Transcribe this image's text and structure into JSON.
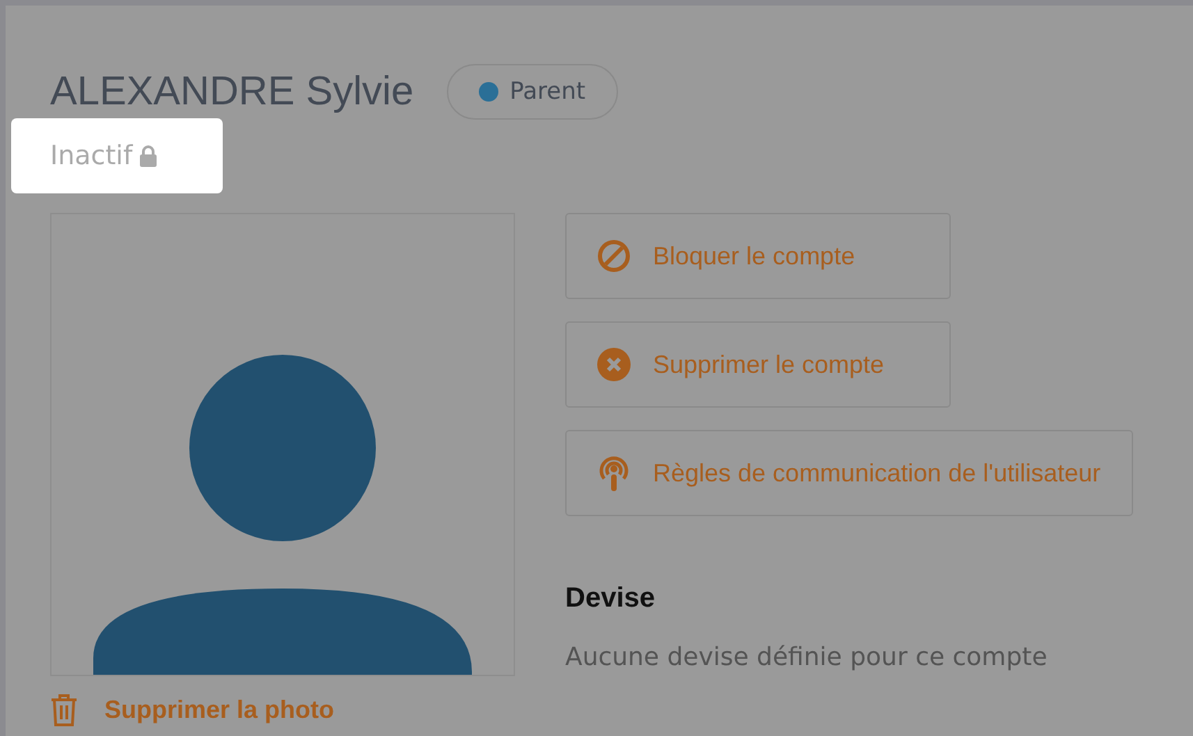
{
  "profile": {
    "name": "ALEXANDRE Sylvie",
    "role_badge": "Parent",
    "status": "Inactif"
  },
  "actions": [
    {
      "kind": "block",
      "label": "Bloquer le compte"
    },
    {
      "kind": "delete",
      "label": "Supprimer le compte"
    },
    {
      "kind": "rules",
      "label": "Règles de communication de l'utilisateur"
    }
  ],
  "photo": {
    "delete_label": "Supprimer la photo"
  },
  "currency": {
    "heading": "Devise",
    "text": "Aucune devise définie pour ce compte"
  }
}
